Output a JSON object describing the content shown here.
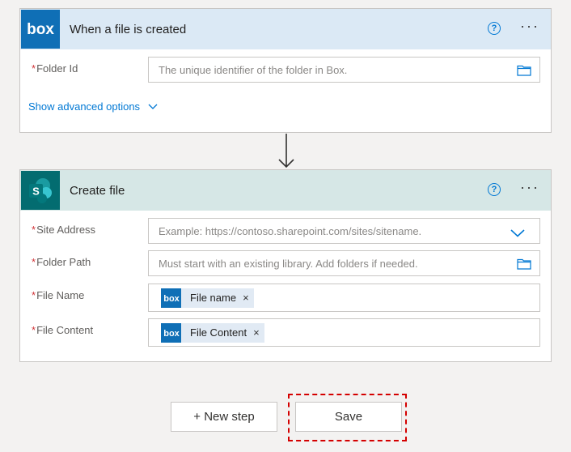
{
  "trigger": {
    "app_icon_text": "box",
    "title": "When a file is created",
    "help_glyph": "?",
    "more_glyph": "···",
    "fields": [
      {
        "required_mark": "*",
        "label": "Folder Id",
        "placeholder": "The unique identifier of the folder in Box."
      }
    ],
    "advanced_link": "Show advanced options",
    "header_color": "#dbe9f5",
    "icon_color": "#0f6fb6"
  },
  "action": {
    "app_icon_text": "S",
    "title": "Create file",
    "help_glyph": "?",
    "more_glyph": "···",
    "header_color": "#d6e7e6",
    "icon_color": "#036c70",
    "fields": [
      {
        "required_mark": "*",
        "label": "Site Address",
        "placeholder": "Example: https://contoso.sharepoint.com/sites/sitename."
      },
      {
        "required_mark": "*",
        "label": "Folder Path",
        "placeholder": "Must start with an existing library. Add folders if needed."
      },
      {
        "required_mark": "*",
        "label": "File Name",
        "token": {
          "icon_text": "box",
          "label": "File name",
          "remove": "×"
        }
      },
      {
        "required_mark": "*",
        "label": "File Content",
        "token": {
          "icon_text": "box",
          "label": "File Content",
          "remove": "×"
        }
      }
    ]
  },
  "footer": {
    "new_step_label": "+ New step",
    "save_label": "Save",
    "highlight_color": "#d40000"
  }
}
